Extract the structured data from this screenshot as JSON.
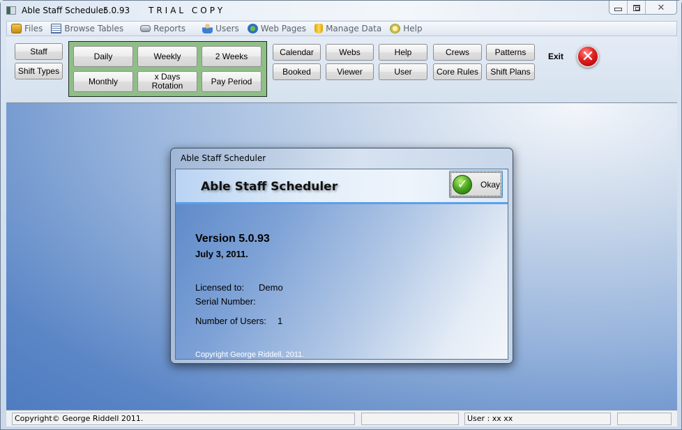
{
  "window": {
    "title": "Able Staff Scheduler",
    "version": "5.0.93",
    "trial_label": "TRIAL COPY",
    "controls": {
      "minimize": "minimize",
      "maximize": "maximize",
      "close": "close"
    }
  },
  "menu": {
    "items": [
      {
        "label": "Files",
        "icon": "folder-icon"
      },
      {
        "label": "Browse Tables",
        "icon": "table-icon"
      },
      {
        "label": "Reports",
        "icon": "printer-icon"
      },
      {
        "label": "Users",
        "icon": "users-icon"
      },
      {
        "label": "Web Pages",
        "icon": "globe-icon"
      },
      {
        "label": "Manage Data",
        "icon": "database-icon"
      },
      {
        "label": "Help",
        "icon": "help-icon"
      }
    ]
  },
  "toolbar": {
    "staff": "Staff",
    "shift_types": "Shift Types",
    "views": {
      "daily": "Daily",
      "weekly": "Weekly",
      "two_weeks": "2 Weeks",
      "monthly": "Monthly",
      "x_days_line1": "x Days",
      "x_days_line2": "Rotation",
      "pay_period": "Pay Period"
    },
    "calendar": "Calendar",
    "booked": "Booked",
    "webs": "Webs",
    "viewer": "Viewer",
    "help": "Help",
    "user": "User",
    "crews": "Crews",
    "core_rules": "Core Rules",
    "patterns": "Patterns",
    "shift_plans": "Shift  Plans",
    "exit": "Exit",
    "accent_green": "#8fbf87"
  },
  "dialog": {
    "title": "Able Staff Scheduler",
    "heading": "Able Staff Scheduler",
    "okay": "Okay",
    "version": "Version 5.0.93",
    "date": "July 3, 2011.",
    "licensed_label": "Licensed to:",
    "licensed_value": "Demo",
    "serial_label": "Serial Number:",
    "users_label": "Number of Users:",
    "users_value": "1",
    "copyright": "Copyright George Riddell, 2011."
  },
  "status": {
    "copyright": "Copyright© George Riddell 2011.",
    "pane2": "",
    "user": "User : xx xx",
    "pane4": ""
  }
}
